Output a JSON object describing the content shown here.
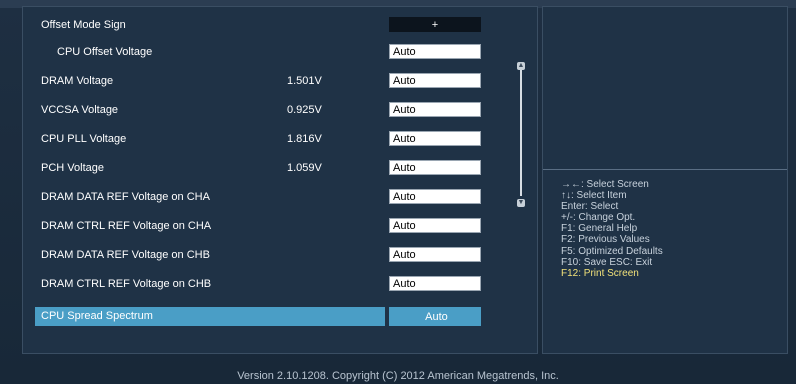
{
  "settings": [
    {
      "label": "Offset Mode Sign",
      "reading": "",
      "value": "+",
      "style": "dark",
      "indent": false
    },
    {
      "label": "CPU Offset Voltage",
      "reading": "",
      "value": "Auto",
      "style": "box",
      "indent": true
    },
    {
      "label": "DRAM Voltage",
      "reading": "1.501V",
      "value": "Auto",
      "style": "box",
      "indent": false
    },
    {
      "label": "VCCSA Voltage",
      "reading": "0.925V",
      "value": "Auto",
      "style": "box",
      "indent": false
    },
    {
      "label": "CPU PLL Voltage",
      "reading": "1.816V",
      "value": "Auto",
      "style": "box",
      "indent": false
    },
    {
      "label": "PCH Voltage",
      "reading": "1.059V",
      "value": "Auto",
      "style": "box",
      "indent": false
    },
    {
      "label": "DRAM DATA REF Voltage on CHA",
      "reading": "",
      "value": "Auto",
      "style": "box",
      "indent": false
    },
    {
      "label": "DRAM CTRL REF Voltage on CHA",
      "reading": "",
      "value": "Auto",
      "style": "box",
      "indent": false
    },
    {
      "label": "DRAM DATA REF Voltage on CHB",
      "reading": "",
      "value": "Auto",
      "style": "box",
      "indent": false
    },
    {
      "label": "DRAM CTRL REF Voltage on CHB",
      "reading": "",
      "value": "Auto",
      "style": "box",
      "indent": false
    },
    {
      "label": "CPU Spread Spectrum",
      "reading": "",
      "value": "Auto",
      "style": "selected",
      "indent": false
    }
  ],
  "help": [
    "→←: Select Screen",
    "↑↓: Select Item",
    "Enter: Select",
    "+/-: Change Opt.",
    "F1: General Help",
    "F2: Previous Values",
    "F5: Optimized Defaults",
    "F10: Save   ESC: Exit",
    "F12: Print Screen"
  ],
  "footer": {
    "version": "Version  2.10.1208.  Copyright  (C)  2012  American  Megatrends,  Inc."
  },
  "icons": {
    "scroll_up": "scroll-up-arrow-icon",
    "scroll_down": "scroll-down-arrow-icon"
  },
  "colors": {
    "selection": "#4a9ec6",
    "highlight_text": "#f2e27a",
    "panel": "#1f3246"
  }
}
